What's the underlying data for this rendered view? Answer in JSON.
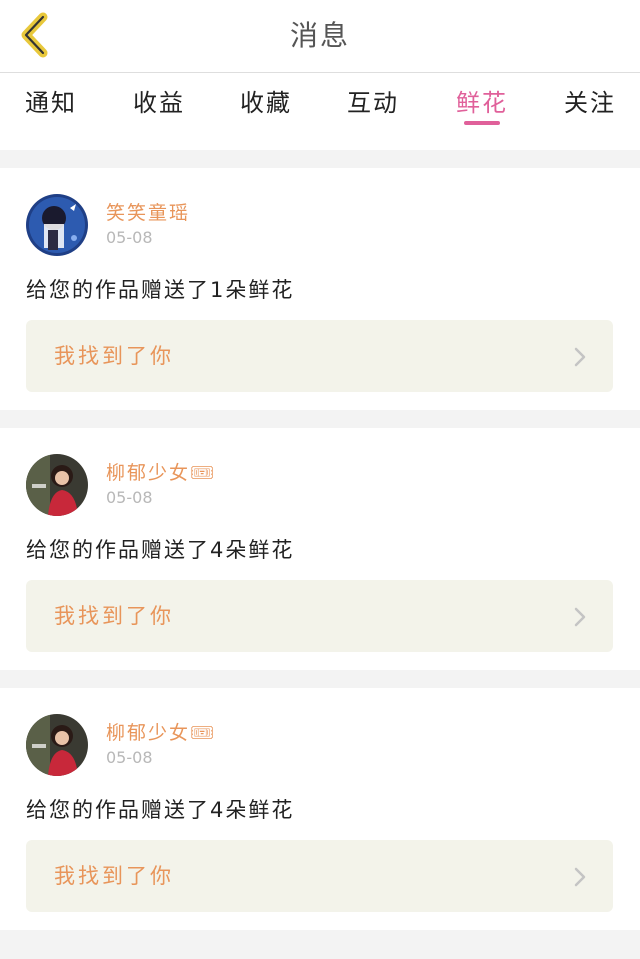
{
  "header": {
    "title": "消息"
  },
  "tabs": [
    {
      "label": "通知"
    },
    {
      "label": "收益"
    },
    {
      "label": "收藏"
    },
    {
      "label": "互动"
    },
    {
      "label": "鲜花"
    },
    {
      "label": "关注"
    }
  ],
  "active_tab": "鲜花",
  "accent_color": "#e0609a",
  "name_color": "#e8955a",
  "messages": [
    {
      "name": "笑笑童瑶",
      "date": "05-08",
      "text": "给您的作品赠送了1朵鲜花",
      "work_title": "我找到了你"
    },
    {
      "name": "柳郁少女🎟",
      "date": "05-08",
      "text": "给您的作品赠送了4朵鲜花",
      "work_title": "我找到了你"
    },
    {
      "name": "柳郁少女🎟",
      "date": "05-08",
      "text": "给您的作品赠送了4朵鲜花",
      "work_title": "我找到了你"
    }
  ]
}
